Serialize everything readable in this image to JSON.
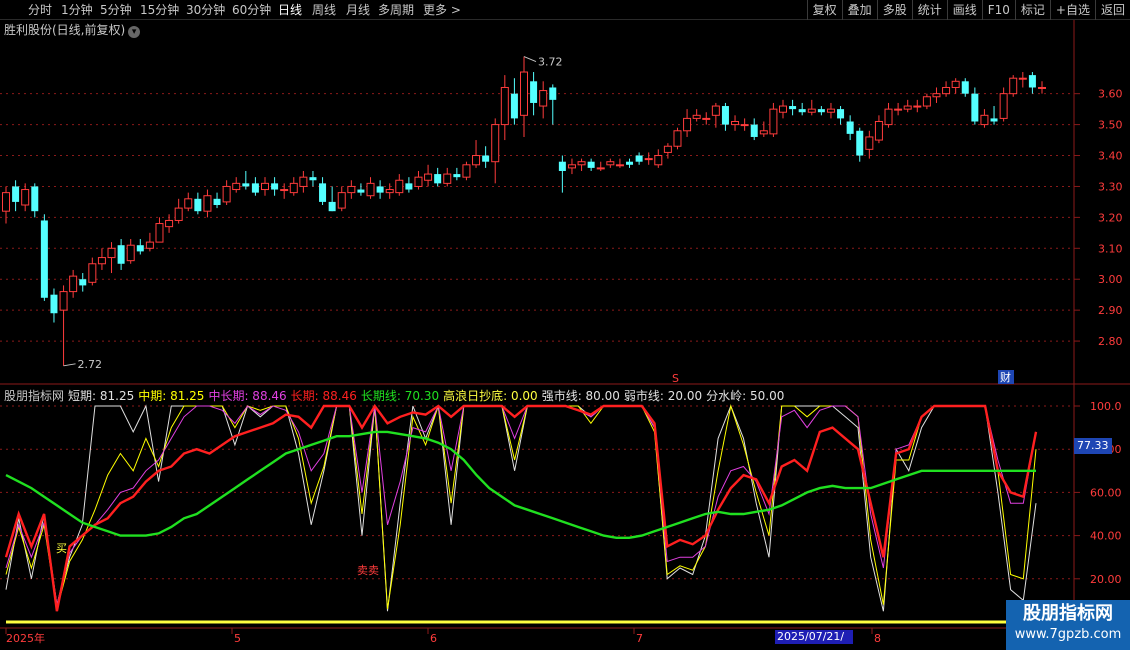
{
  "toolbar": {
    "periods": [
      "分时",
      "1分钟",
      "5分钟",
      "15分钟",
      "30分钟",
      "60分钟",
      "日线",
      "周线",
      "月线",
      "多周期",
      "更多 >"
    ],
    "active_period": "日线",
    "right_buttons": [
      "复权",
      "叠加",
      "多股",
      "统计",
      "画线",
      "F10",
      "标记",
      "+自选",
      "返回"
    ]
  },
  "stock": {
    "title": "胜利股份(日线,前复权)"
  },
  "price_axis": {
    "labels": [
      "3.60",
      "3.50",
      "3.40",
      "3.30",
      "3.20",
      "3.10",
      "3.00",
      "2.90",
      "2.80"
    ],
    "values": [
      3.6,
      3.5,
      3.4,
      3.3,
      3.2,
      3.1,
      3.0,
      2.9,
      2.8
    ]
  },
  "annotations": {
    "high": "3.72",
    "low": "2.72",
    "marker_s": "S",
    "marker_cai": "财",
    "buy_label": "买",
    "sell_label": "卖卖"
  },
  "indicator": {
    "name": "股朋指标网",
    "items": [
      {
        "label": "短期: 81.25",
        "color": "#e0e0e0"
      },
      {
        "label": "中期: 81.25",
        "color": "#ffff00"
      },
      {
        "label": "中长期: 88.46",
        "color": "#e040e0"
      },
      {
        "label": "长期: 88.46",
        "color": "#ff2020"
      },
      {
        "label": "长期线: 70.30",
        "color": "#20e020"
      },
      {
        "label": "高浪日抄底: 0.00",
        "color": "#ffff40"
      },
      {
        "label": "强市线: 80.00",
        "color": "#e0e0e0"
      },
      {
        "label": "弱市线: 20.00",
        "color": "#e0e0e0"
      },
      {
        "label": "分水岭: 50.00",
        "color": "#e0e0e0"
      }
    ],
    "axis_labels": [
      "100.0",
      "80.00",
      "60.00",
      "40.00",
      "20.00"
    ],
    "axis_values": [
      100,
      80,
      60,
      40,
      20
    ],
    "current_value": "77.33"
  },
  "date_axis": {
    "labels": [
      "2025年",
      "5",
      "6",
      "7",
      "8"
    ],
    "cursor_date": "2025/07/21/—"
  },
  "watermark": {
    "line1": "股朋指标网",
    "line2": "www.7gpzb.com"
  },
  "colors": {
    "up": "#ff3c3c",
    "down": "#54ffff",
    "grid": "#8b1a1a",
    "axis_text": "#ff3c3c"
  },
  "chart_data": {
    "type": "candlestick",
    "ylim": [
      2.7,
      3.78
    ],
    "candles": [
      [
        3.22,
        3.28,
        3.3,
        3.18
      ],
      [
        3.3,
        3.25,
        3.32,
        3.22
      ],
      [
        3.24,
        3.29,
        3.31,
        3.22
      ],
      [
        3.3,
        3.22,
        3.31,
        3.2
      ],
      [
        3.19,
        2.94,
        3.21,
        2.93
      ],
      [
        2.95,
        2.89,
        2.97,
        2.86
      ],
      [
        2.9,
        2.96,
        2.98,
        2.72
      ],
      [
        2.96,
        3.01,
        3.03,
        2.94
      ],
      [
        3.0,
        2.98,
        3.02,
        2.96
      ],
      [
        2.99,
        3.05,
        3.07,
        2.98
      ],
      [
        3.05,
        3.07,
        3.1,
        3.03
      ],
      [
        3.07,
        3.1,
        3.12,
        3.02
      ],
      [
        3.11,
        3.05,
        3.13,
        3.03
      ],
      [
        3.06,
        3.11,
        3.13,
        3.05
      ],
      [
        3.11,
        3.09,
        3.13,
        3.08
      ],
      [
        3.1,
        3.12,
        3.15,
        3.09
      ],
      [
        3.12,
        3.18,
        3.2,
        3.12
      ],
      [
        3.17,
        3.19,
        3.21,
        3.15
      ],
      [
        3.19,
        3.23,
        3.26,
        3.18
      ],
      [
        3.23,
        3.26,
        3.28,
        3.22
      ],
      [
        3.26,
        3.22,
        3.28,
        3.21
      ],
      [
        3.22,
        3.27,
        3.29,
        3.2
      ],
      [
        3.26,
        3.24,
        3.28,
        3.23
      ],
      [
        3.25,
        3.3,
        3.32,
        3.24
      ],
      [
        3.29,
        3.31,
        3.33,
        3.28
      ],
      [
        3.31,
        3.3,
        3.35,
        3.29
      ],
      [
        3.31,
        3.28,
        3.33,
        3.27
      ],
      [
        3.29,
        3.31,
        3.33,
        3.27
      ],
      [
        3.31,
        3.29,
        3.33,
        3.27
      ],
      [
        3.29,
        3.29,
        3.31,
        3.26
      ],
      [
        3.28,
        3.31,
        3.33,
        3.27
      ],
      [
        3.3,
        3.33,
        3.35,
        3.28
      ],
      [
        3.33,
        3.32,
        3.35,
        3.3
      ],
      [
        3.31,
        3.25,
        3.33,
        3.24
      ],
      [
        3.25,
        3.22,
        3.3,
        3.22
      ],
      [
        3.23,
        3.28,
        3.3,
        3.22
      ],
      [
        3.28,
        3.3,
        3.32,
        3.26
      ],
      [
        3.29,
        3.28,
        3.31,
        3.27
      ],
      [
        3.27,
        3.31,
        3.33,
        3.26
      ],
      [
        3.3,
        3.28,
        3.32,
        3.26
      ],
      [
        3.28,
        3.29,
        3.31,
        3.26
      ],
      [
        3.28,
        3.32,
        3.34,
        3.27
      ],
      [
        3.31,
        3.29,
        3.33,
        3.28
      ],
      [
        3.3,
        3.33,
        3.35,
        3.29
      ],
      [
        3.32,
        3.34,
        3.37,
        3.3
      ],
      [
        3.34,
        3.31,
        3.36,
        3.3
      ],
      [
        3.31,
        3.34,
        3.36,
        3.3
      ],
      [
        3.34,
        3.33,
        3.36,
        3.32
      ],
      [
        3.33,
        3.37,
        3.38,
        3.32
      ],
      [
        3.37,
        3.4,
        3.45,
        3.36
      ],
      [
        3.4,
        3.38,
        3.43,
        3.36
      ],
      [
        3.38,
        3.5,
        3.52,
        3.31
      ],
      [
        3.5,
        3.62,
        3.66,
        3.45
      ],
      [
        3.6,
        3.52,
        3.65,
        3.5
      ],
      [
        3.53,
        3.67,
        3.72,
        3.46
      ],
      [
        3.64,
        3.57,
        3.67,
        3.53
      ],
      [
        3.56,
        3.61,
        3.64,
        3.52
      ],
      [
        3.62,
        3.58,
        3.63,
        3.5
      ],
      [
        3.38,
        3.35,
        3.4,
        3.28
      ],
      [
        3.36,
        3.37,
        3.39,
        3.34
      ],
      [
        3.37,
        3.38,
        3.39,
        3.35
      ],
      [
        3.38,
        3.36,
        3.39,
        3.35
      ],
      [
        3.36,
        3.36,
        3.38,
        3.35
      ],
      [
        3.37,
        3.38,
        3.39,
        3.36
      ],
      [
        3.37,
        3.37,
        3.39,
        3.36
      ],
      [
        3.38,
        3.37,
        3.39,
        3.36
      ],
      [
        3.4,
        3.38,
        3.41,
        3.37
      ],
      [
        3.39,
        3.39,
        3.41,
        3.37
      ],
      [
        3.37,
        3.4,
        3.42,
        3.36
      ],
      [
        3.41,
        3.43,
        3.44,
        3.39
      ],
      [
        3.43,
        3.48,
        3.49,
        3.42
      ],
      [
        3.48,
        3.52,
        3.55,
        3.46
      ],
      [
        3.52,
        3.53,
        3.55,
        3.51
      ],
      [
        3.52,
        3.52,
        3.54,
        3.5
      ],
      [
        3.53,
        3.56,
        3.57,
        3.49
      ],
      [
        3.56,
        3.5,
        3.57,
        3.48
      ],
      [
        3.5,
        3.51,
        3.53,
        3.48
      ],
      [
        3.5,
        3.5,
        3.52,
        3.48
      ],
      [
        3.5,
        3.46,
        3.52,
        3.45
      ],
      [
        3.47,
        3.48,
        3.51,
        3.46
      ],
      [
        3.47,
        3.55,
        3.57,
        3.46
      ],
      [
        3.54,
        3.56,
        3.58,
        3.52
      ],
      [
        3.56,
        3.55,
        3.58,
        3.53
      ],
      [
        3.55,
        3.54,
        3.57,
        3.53
      ],
      [
        3.54,
        3.55,
        3.58,
        3.53
      ],
      [
        3.55,
        3.54,
        3.56,
        3.53
      ],
      [
        3.54,
        3.55,
        3.57,
        3.52
      ],
      [
        3.55,
        3.52,
        3.56,
        3.5
      ],
      [
        3.51,
        3.47,
        3.53,
        3.45
      ],
      [
        3.48,
        3.4,
        3.49,
        3.38
      ],
      [
        3.42,
        3.46,
        3.48,
        3.39
      ],
      [
        3.45,
        3.51,
        3.53,
        3.44
      ],
      [
        3.5,
        3.55,
        3.57,
        3.49
      ],
      [
        3.55,
        3.55,
        3.57,
        3.53
      ],
      [
        3.55,
        3.56,
        3.58,
        3.54
      ],
      [
        3.56,
        3.56,
        3.58,
        3.54
      ],
      [
        3.56,
        3.59,
        3.6,
        3.55
      ],
      [
        3.59,
        3.6,
        3.62,
        3.57
      ],
      [
        3.6,
        3.62,
        3.64,
        3.59
      ],
      [
        3.62,
        3.64,
        3.65,
        3.6
      ],
      [
        3.64,
        3.6,
        3.65,
        3.59
      ],
      [
        3.6,
        3.51,
        3.62,
        3.5
      ],
      [
        3.5,
        3.53,
        3.55,
        3.49
      ],
      [
        3.52,
        3.51,
        3.56,
        3.5
      ],
      [
        3.52,
        3.6,
        3.62,
        3.51
      ],
      [
        3.6,
        3.65,
        3.66,
        3.59
      ],
      [
        3.65,
        3.65,
        3.67,
        3.62
      ],
      [
        3.66,
        3.62,
        3.67,
        3.6
      ],
      [
        3.62,
        3.62,
        3.64,
        3.6
      ]
    ],
    "series": [
      {
        "name": "短期",
        "color": "#e0e0e0",
        "values": [
          15,
          48,
          20,
          50,
          8,
          30,
          45,
          100,
          100,
          100,
          88,
          100,
          65,
          100,
          100,
          100,
          100,
          100,
          82,
          100,
          95,
          100,
          100,
          78,
          45,
          70,
          100,
          100,
          40,
          100,
          5,
          55,
          100,
          85,
          100,
          45,
          100,
          100,
          100,
          100,
          70,
          100,
          100,
          100,
          100,
          100,
          95,
          100,
          100,
          100,
          100,
          90,
          20,
          25,
          22,
          40,
          85,
          100,
          85,
          55,
          30,
          100,
          100,
          100,
          100,
          100,
          95,
          90,
          30,
          5,
          80,
          70,
          90,
          100,
          100,
          100,
          100,
          100,
          60,
          15,
          10,
          55
        ]
      },
      {
        "name": "中期",
        "color": "#ffff00",
        "values": [
          22,
          44,
          25,
          45,
          6,
          28,
          38,
          52,
          68,
          78,
          70,
          85,
          72,
          90,
          100,
          100,
          100,
          100,
          90,
          100,
          98,
          100,
          100,
          85,
          55,
          72,
          100,
          100,
          50,
          100,
          6,
          45,
          95,
          82,
          100,
          55,
          100,
          100,
          100,
          100,
          75,
          100,
          100,
          100,
          100,
          100,
          92,
          100,
          100,
          100,
          100,
          88,
          22,
          26,
          24,
          35,
          70,
          100,
          82,
          60,
          40,
          100,
          100,
          95,
          100,
          100,
          100,
          95,
          38,
          8,
          75,
          75,
          95,
          100,
          100,
          100,
          100,
          100,
          70,
          22,
          20,
          80
        ]
      },
      {
        "name": "中长期",
        "color": "#e040e0",
        "values": [
          25,
          45,
          30,
          46,
          8,
          32,
          40,
          45,
          52,
          60,
          62,
          70,
          75,
          85,
          95,
          100,
          100,
          98,
          92,
          100,
          96,
          100,
          98,
          88,
          70,
          78,
          100,
          100,
          60,
          100,
          45,
          65,
          90,
          88,
          100,
          70,
          100,
          100,
          100,
          100,
          85,
          100,
          100,
          100,
          100,
          98,
          95,
          100,
          100,
          100,
          100,
          90,
          28,
          30,
          30,
          35,
          58,
          70,
          72,
          65,
          50,
          95,
          98,
          90,
          98,
          100,
          100,
          95,
          50,
          25,
          80,
          82,
          95,
          100,
          100,
          100,
          100,
          100,
          75,
          55,
          55,
          88
        ]
      },
      {
        "name": "长期",
        "color": "#ff2020",
        "values": [
          30,
          50,
          35,
          50,
          5,
          35,
          40,
          45,
          48,
          55,
          58,
          65,
          70,
          72,
          78,
          80,
          78,
          82,
          86,
          88,
          90,
          92,
          96,
          95,
          90,
          100,
          100,
          100,
          90,
          100,
          92,
          95,
          97,
          96,
          100,
          95,
          100,
          100,
          100,
          100,
          95,
          100,
          100,
          100,
          100,
          98,
          96,
          100,
          100,
          100,
          100,
          92,
          35,
          38,
          36,
          40,
          52,
          62,
          68,
          66,
          55,
          72,
          75,
          70,
          88,
          90,
          85,
          80,
          55,
          30,
          78,
          80,
          95,
          100,
          100,
          100,
          100,
          100,
          70,
          60,
          58,
          88
        ]
      },
      {
        "name": "长期线",
        "color": "#20e020",
        "values": [
          68,
          65,
          62,
          58,
          54,
          50,
          46,
          44,
          42,
          40,
          40,
          40,
          41,
          44,
          48,
          50,
          54,
          58,
          62,
          66,
          70,
          74,
          78,
          80,
          82,
          84,
          86,
          86,
          87,
          88,
          88,
          87,
          86,
          85,
          83,
          80,
          75,
          68,
          62,
          58,
          54,
          52,
          50,
          48,
          46,
          44,
          42,
          40,
          39,
          39,
          40,
          42,
          44,
          46,
          48,
          50,
          51,
          50,
          50,
          51,
          52,
          54,
          57,
          60,
          62,
          63,
          62,
          62,
          62,
          64,
          66,
          68,
          70,
          70,
          70,
          70,
          70,
          70,
          70,
          70,
          70,
          70
        ]
      },
      {
        "name": "高浪日抄底",
        "color": "#ffff40",
        "values": [
          0,
          0,
          0,
          0,
          0,
          0,
          0,
          0,
          0,
          0,
          0,
          0,
          0,
          0,
          0,
          0,
          0,
          0,
          0,
          0,
          0,
          0,
          0,
          0,
          0,
          0,
          0,
          0,
          0,
          0,
          0,
          0,
          0,
          0,
          0,
          0,
          0,
          0,
          0,
          0,
          0,
          0,
          0,
          0,
          0,
          0,
          0,
          0,
          0,
          0,
          0,
          0,
          0,
          0,
          0,
          0,
          0,
          0,
          0,
          0,
          0,
          0,
          0,
          0,
          0,
          0,
          0,
          0,
          0,
          0,
          0,
          0,
          0,
          0,
          0,
          0,
          0,
          0,
          0,
          0,
          0,
          0
        ]
      }
    ],
    "ind_ylim": [
      0,
      100
    ],
    "lines": {
      "strong": 80,
      "weak": 20,
      "divide": 50
    }
  }
}
